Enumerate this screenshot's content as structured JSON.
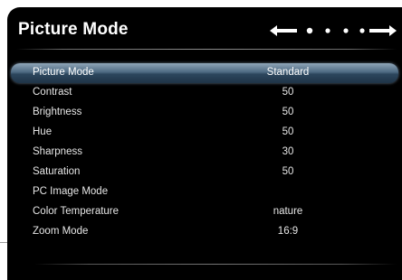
{
  "title": "Picture Mode",
  "nav": {
    "page_count": 4,
    "active_index": 0
  },
  "menu": {
    "items": [
      {
        "label": "Picture Mode",
        "value": "Standard",
        "selected": true
      },
      {
        "label": "Contrast",
        "value": "50"
      },
      {
        "label": "Brightness",
        "value": "50"
      },
      {
        "label": "Hue",
        "value": "50"
      },
      {
        "label": "Sharpness",
        "value": "30"
      },
      {
        "label": "Saturation",
        "value": "50"
      },
      {
        "label": "PC Image Mode",
        "value": ""
      },
      {
        "label": "Color Temperature",
        "value": "nature"
      },
      {
        "label": "Zoom Mode",
        "value": "16:9"
      }
    ]
  },
  "colors": {
    "background": "#000000",
    "text": "#e6e6e6",
    "highlight": "#4d6a82"
  }
}
